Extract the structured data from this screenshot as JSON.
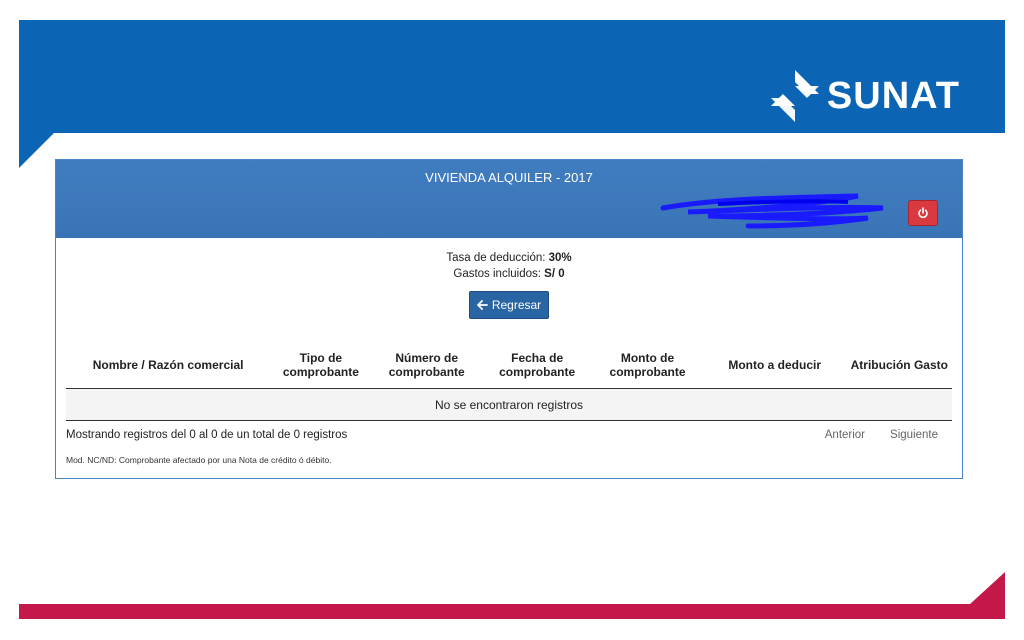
{
  "brand": {
    "name": "SUNAT",
    "colors": {
      "primary_blue": "#0b64b4",
      "accent_red": "#c4174a",
      "panel_blue": "#3f7dc0"
    }
  },
  "panel": {
    "title": "VIVIENDA ALQUILER - 2017",
    "power_icon": "power-icon"
  },
  "info": {
    "rate_label": "Tasa de deducción:",
    "rate_value": "30%",
    "expenses_label": "Gastos incluidos:",
    "expenses_value": "S/ 0"
  },
  "back_button": {
    "label": "Regresar",
    "icon": "arrow-left-icon"
  },
  "table": {
    "headers": [
      "Nombre / Razón comercial",
      "Tipo de comprobante",
      "Número de comprobante",
      "Fecha de comprobante",
      "Monto de comprobante",
      "Monto a deducir",
      "Atribución Gasto"
    ],
    "empty_message": "No se encontraron registros"
  },
  "footer": {
    "summary": "Mostrando registros del 0 al 0 de un total de 0 registros",
    "prev": "Anterior",
    "next": "Siguiente",
    "note": "Mod. NC/ND: Comprobante afectado por una Nota de crédito ó débito."
  }
}
